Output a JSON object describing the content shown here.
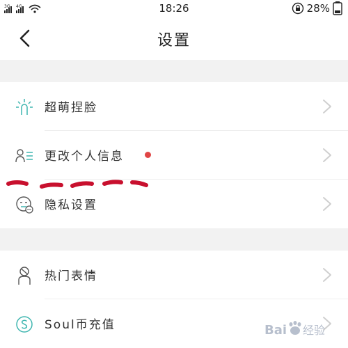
{
  "status_bar": {
    "network_1": "3G",
    "network_2": "4G",
    "time": "18:26",
    "battery_percent": "28%",
    "icons": [
      "signal-icon",
      "wifi-icon",
      "rotation-lock-icon",
      "battery-icon"
    ]
  },
  "header": {
    "title": "设置",
    "back_icon": "chevron-left-icon"
  },
  "groups": [
    {
      "items": [
        {
          "label": "超萌捏脸",
          "icon": "face-sparkle-icon",
          "highlight_color": "#3fb6b0"
        },
        {
          "label": "更改个人信息",
          "icon": "profile-list-icon",
          "badge": "red-dot",
          "highlight_color": "#3fb6b0"
        },
        {
          "label": "隐私设置",
          "icon": "privacy-face-icon",
          "highlight_color": "#3fb6b0"
        }
      ]
    },
    {
      "items": [
        {
          "label": "热门表情",
          "icon": "sticker-person-icon"
        },
        {
          "label": "Soul币充值",
          "icon": "soul-coin-icon",
          "highlight_color": "#3fb6b0"
        }
      ]
    }
  ],
  "annotation": {
    "color": "#c8102e",
    "style": "dashed-underline"
  },
  "watermark": {
    "text": "Baidu经验"
  }
}
